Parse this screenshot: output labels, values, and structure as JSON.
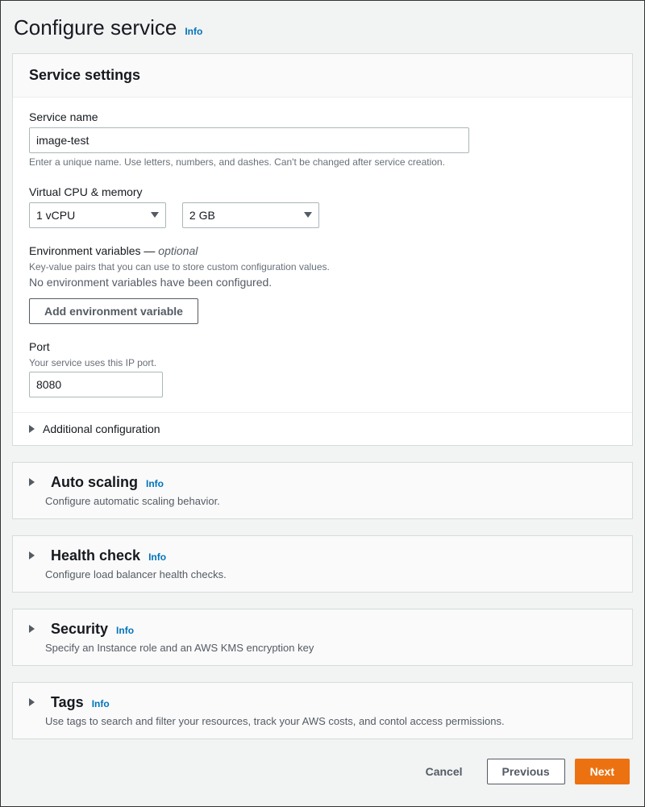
{
  "page": {
    "title": "Configure service",
    "info": "Info"
  },
  "service_settings": {
    "heading": "Service settings",
    "service_name": {
      "label": "Service name",
      "value": "image-test",
      "hint": "Enter a unique name. Use letters, numbers, and dashes. Can't be changed after service creation."
    },
    "vcpu_memory": {
      "label": "Virtual CPU & memory",
      "vcpu": "1 vCPU",
      "memory": "2 GB"
    },
    "env_vars": {
      "label": "Environment variables —",
      "optional": " optional",
      "hint": "Key-value pairs that you can use to store custom configuration values.",
      "empty_text": "No environment variables have been configured.",
      "add_button": "Add environment variable"
    },
    "port": {
      "label": "Port",
      "hint": "Your service uses this IP port.",
      "value": "8080"
    },
    "additional_config": "Additional configuration"
  },
  "sections": {
    "auto_scaling": {
      "title": "Auto scaling",
      "info": "Info",
      "desc": "Configure automatic scaling behavior."
    },
    "health_check": {
      "title": "Health check",
      "info": "Info",
      "desc": "Configure load balancer health checks."
    },
    "security": {
      "title": "Security",
      "info": "Info",
      "desc": "Specify an Instance role and an AWS KMS encryption key"
    },
    "tags": {
      "title": "Tags",
      "info": "Info",
      "desc": "Use tags to search and filter your resources, track your AWS costs, and contol access permissions."
    }
  },
  "footer": {
    "cancel": "Cancel",
    "previous": "Previous",
    "next": "Next"
  }
}
